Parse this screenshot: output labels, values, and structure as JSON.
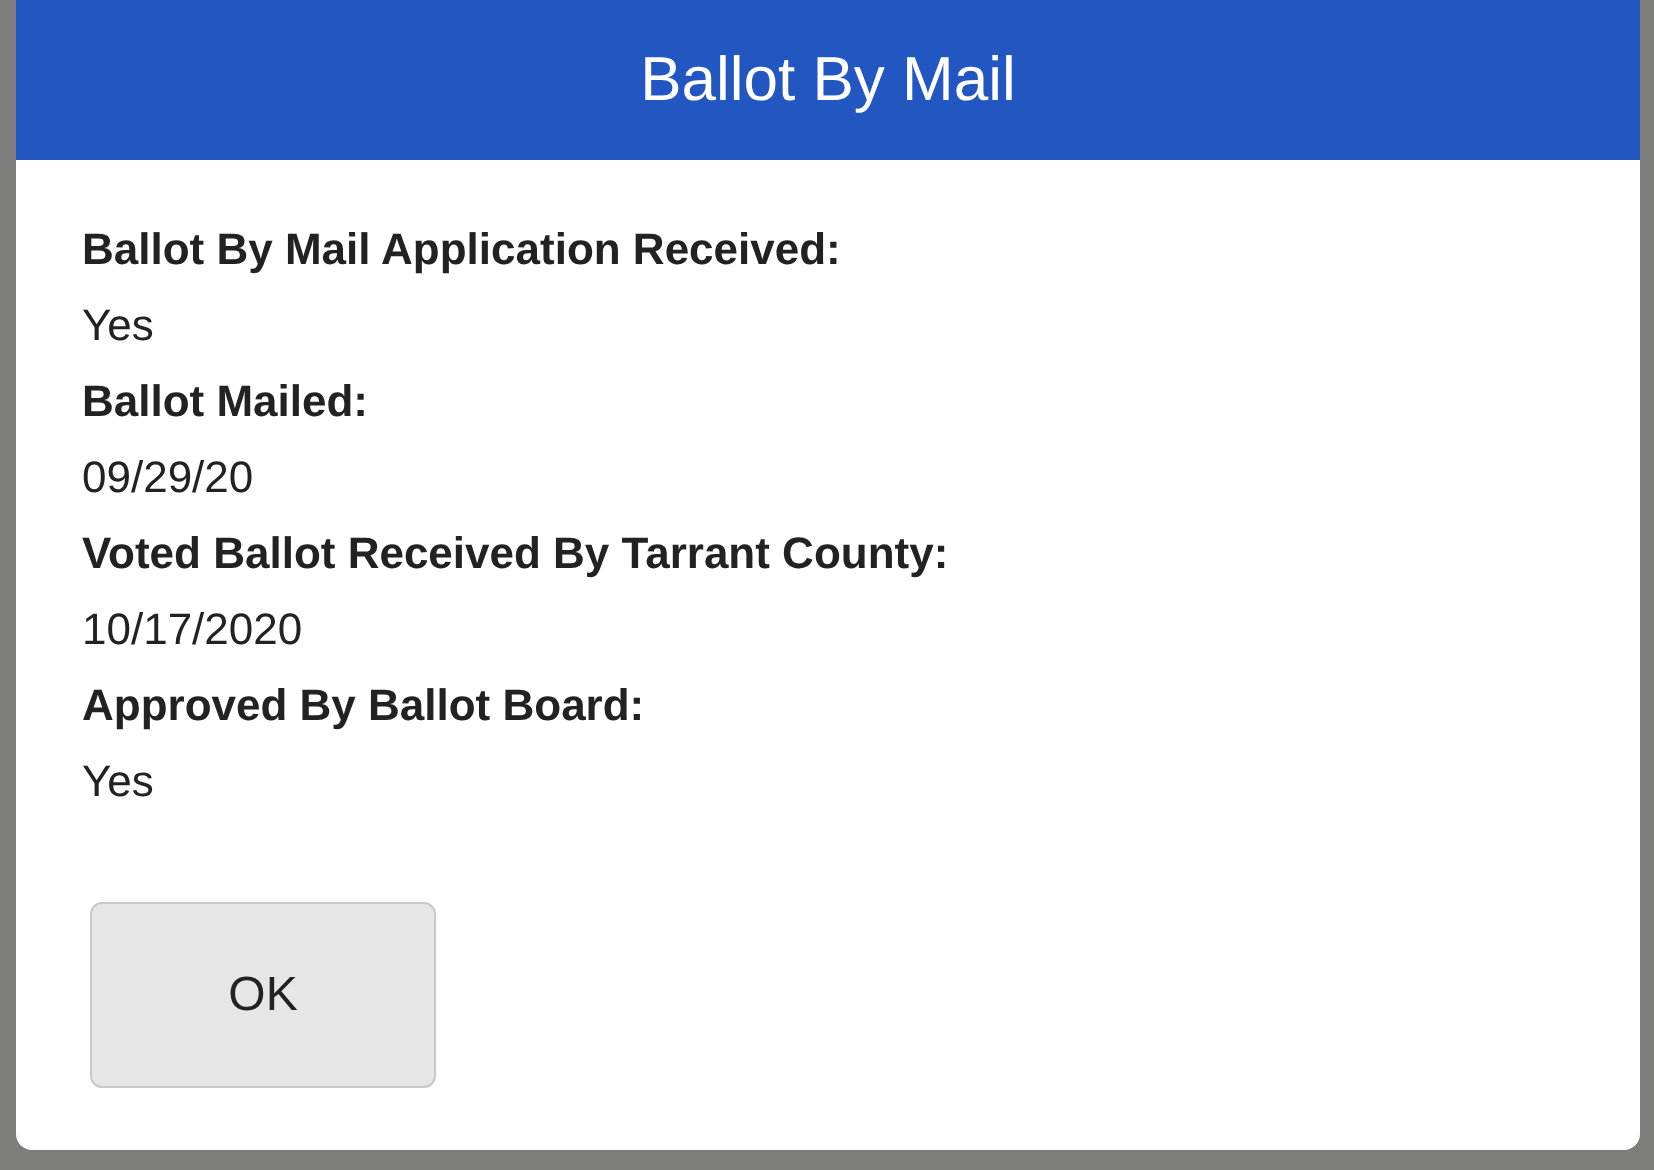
{
  "dialog": {
    "title": "Ballot By Mail",
    "fields": [
      {
        "label": "Ballot By Mail Application Received:",
        "value": "Yes"
      },
      {
        "label": "Ballot Mailed:",
        "value": "09/29/20"
      },
      {
        "label": "Voted Ballot Received By Tarrant County:",
        "value": "10/17/2020"
      },
      {
        "label": "Approved By Ballot Board:",
        "value": "Yes"
      }
    ],
    "buttons": [
      "OK"
    ]
  }
}
